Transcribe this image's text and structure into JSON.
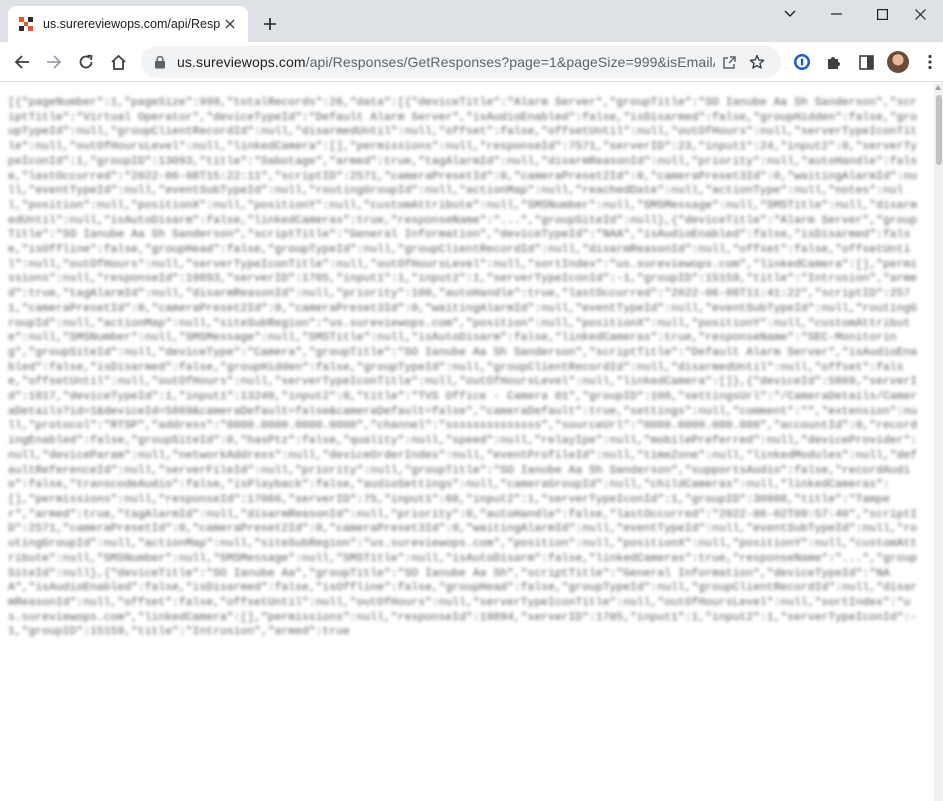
{
  "tab": {
    "title": "us.surereviewops.com/api/Respons",
    "favicon": "sureview-logo-icon",
    "close_glyph": "✕"
  },
  "window": {
    "new_tab_glyph": "+",
    "minimize_glyph": "⌄"
  },
  "address_bar": {
    "host": "us.sureviewops.com",
    "path": "/api/Responses/GetResponses?page=1&pageSize=999&isEmailA..."
  },
  "page": {
    "body_text": "[{\"pageNumber\":1,\"pageSize\":999,\"totalRecords\":26,\"data\":[{\"deviceTitle\":\"Alarm Server\",\"groupTitle\":\"SO Ianube Aa Sh Sanderson\",\"scriptTitle\":\"Virtual Operator\",\"deviceTypeId\":\"Default Alarm Server\",\"isAudioEnabled\":false,\"isDisarmed\":false,\"groupHidden\":false,\"groupTypeId\":null,\"groupClientRecordId\":null,\"disarmedUntil\":null,\"offset\":false,\"offsetUntil\":null,\"outOfHours\":null,\"serverTypeIconTitle\":null,\"outOfHoursLevel\":null,\"linkedCamera\":[],\"permissions\":null,\"responseId\":7571,\"serverID\":23,\"input1\":24,\"input2\":0,\"serverTypeIconId\":1,\"groupID\":13093,\"title\":\"Sabotage\",\"armed\":true,\"tagAlarmId\":null,\"disarmReasonId\":null,\"priority\":null,\"autoHandle\":false,\"lastOccurred\":\"2022-06-08T15:22:11\",\"scriptID\":2571,\"cameraPresetId\":0,\"cameraPreset2Id\":0,\"cameraPreset3Id\":0,\"waitingAlarmId\":null,\"eventTypeId\":null,\"eventSubTypeId\":null,\"routingGroupId\":null,\"actionMap\":null,\"reachedDate\":null,\"actionType\":null,\"notes\":null,\"position\":null,\"positionX\":null,\"positionY\":null,\"customAttribute\":null,\"SMSNumber\":null,\"SMSMessage\":null,\"SMSTitle\":null,\"disarmedUntil\":null,\"isAutoDisarm\":false,\"linkedCameras\":true,\"responseName\":\"...\",\"groupSiteId\":null},{\"deviceTitle\":\"Alarm Server\",\"groupTitle\":\"SO Ianube Aa Sh Sanderson\",\"scriptTitle\":\"General Information\",\"deviceTypeId\":\"NAA\",\"isAudioEnabled\":false,\"isDisarmed\":false,\"isOffline\":false,\"groupHead\":false,\"groupTypeId\":null,\"groupClientRecordId\":null,\"disarmReasonId\":null,\"offset\":false,\"offsetUntil\":null,\"outOfHours\":null,\"serverTypeIconTitle\":null,\"outOfHoursLevel\":null,\"sortIndex\":\"us.sureviewops.com\",\"linkedCamera\":[],\"permissions\":null,\"responseId\":19893,\"serverID\":1705,\"input1\":1,\"input2\":1,\"serverTypeIconId\":-1,\"groupID\":15159,\"title\":\"Intrusion\",\"armed\":true,\"tagAlarmId\":null,\"disarmReasonId\":null,\"priority\":100,\"autoHandle\":true,\"lastOccurred\":\"2022-06-08T11:41:22\",\"scriptID\":2571,\"cameraPresetId\":0,\"cameraPreset2Id\":0,\"cameraPreset3Id\":0,\"waitingAlarmId\":null,\"eventTypeId\":null,\"eventSubTypeId\":null,\"routingGroupId\":null,\"actionMap\":null,\"siteSubRegion\":\"us.sureviewops.com\",\"position\":null,\"positionX\":null,\"positionY\":null,\"customAttribute\":null,\"SMSNumber\":null,\"SMSMessage\":null,\"SMSTitle\":null,\"isAutoDisarm\":false,\"linkedCameras\":true,\"responseName\":\"SEC-Monitoring\",\"groupSiteId\":null,\"deviceType\":\"Camera\",\"groupTitle\":\"SO Ianube Aa Sh Sanderson\",\"scriptTitle\":\"Default Alarm Server\",\"isAudioEnabled\":false,\"isDisarmed\":false,\"groupHidden\":false,\"groupTypeId\":null,\"groupClientRecordId\":null,\"disarmedUntil\":null,\"offset\":false,\"offsetUntil\":null,\"outOfHours\":null,\"serverTypeIconTitle\":null,\"outOfHoursLevel\":null,\"linkedCamera\":[]},{\"deviceId\":5869,\"serverId\":1817,\"deviceTypeId\":1,\"input1\":13240,\"input2\":0,\"title\":\"TVS Office - Camera 01\",\"groupID\":100,\"settingsUrl\":\"/CameraDetails/CameraDetails?id=1&deviceId=5869&cameraDefault=false&cameraDefault=false\",\"cameraDefault\":true,\"settings\":null,\"comment\":\"\",\"extension\":null,\"protocol\":\"RTSP\",\"address\":\"0000.0000.0000.0000\",\"channel\":\"ssssssssssssss\",\"sourceUrl\":\"0000.0000.000.000\",\"accountId\":0,\"recordingEnabled\":false,\"groupSiteId\":0,\"hasPtz\":false,\"quality\":null,\"speed\":null,\"relayIpe\":null,\"mobilePreferred\":null,\"deviceProvider\":null,\"deviceParam\":null,\"networkAddress\":null,\"deviceOrderIndex\":null,\"eventProfileId\":null,\"timeZone\":null,\"linkedModules\":null,\"defaultReferenceId\":null,\"serverFileId\":null,\"priority\":null,\"groupTitle\":\"SO Ianube Aa Sh Sanderson\",\"supportsAudio\":false,\"recordAudio\":false,\"transcodeAudio\":false,\"isPlayback\":false,\"audioSettings\":null,\"cameraGroupId\":null,\"childCameras\":null,\"linkedCameras\":[],\"permissions\":null,\"responseId\":17066,\"serverID\":75,\"input1\":66,\"input2\":1,\"serverTypeIconId\":1,\"groupID\":30008,\"title\":\"Tamper\",\"armed\":true,\"tagAlarmId\":null,\"disarmReasonId\":null,\"priority\":0,\"autoHandle\":false,\"lastOccurred\":\"2022-06-02T09:57:40\",\"scriptID\":2571,\"cameraPresetId\":0,\"cameraPreset2Id\":0,\"cameraPreset3Id\":0,\"waitingAlarmId\":null,\"eventTypeId\":null,\"eventSubTypeId\":null,\"routingGroupId\":null,\"actionMap\":null,\"siteSubRegion\":\"us.sureviewops.com\",\"position\":null,\"positionX\":null,\"positionY\":null,\"customAttribute\":null,\"SMSNumber\":null,\"SMSMessage\":null,\"SMSTitle\":null,\"isAutoDisarm\":false,\"linkedCameras\":true,\"responseName\":\"...\",\"groupSiteId\":null},{\"deviceTitle\":\"SO Ianube Aa\",\"groupTitle\":\"SO Ianube Aa Sh\",\"scriptTitle\":\"General Information\",\"deviceTypeId\":\"NAA\",\"isAudioEnabled\":false,\"isDisarmed\":false,\"isOffline\":false,\"groupHead\":false,\"groupTypeId\":null,\"groupClientRecordId\":null,\"disarmReasonId\":null,\"offset\":false,\"offsetUntil\":null,\"outOfHours\":null,\"serverTypeIconTitle\":null,\"outOfHoursLevel\":null,\"sortIndex\":\"us.sureviewops.com\",\"linkedCamera\":[],\"permissions\":null,\"responseId\":19894,\"serverID\":1705,\"input1\":1,\"input2\":1,\"serverTypeIconId\":-1,\"groupID\":15159,\"title\":\"Intrusion\",\"armed\":true"
  }
}
